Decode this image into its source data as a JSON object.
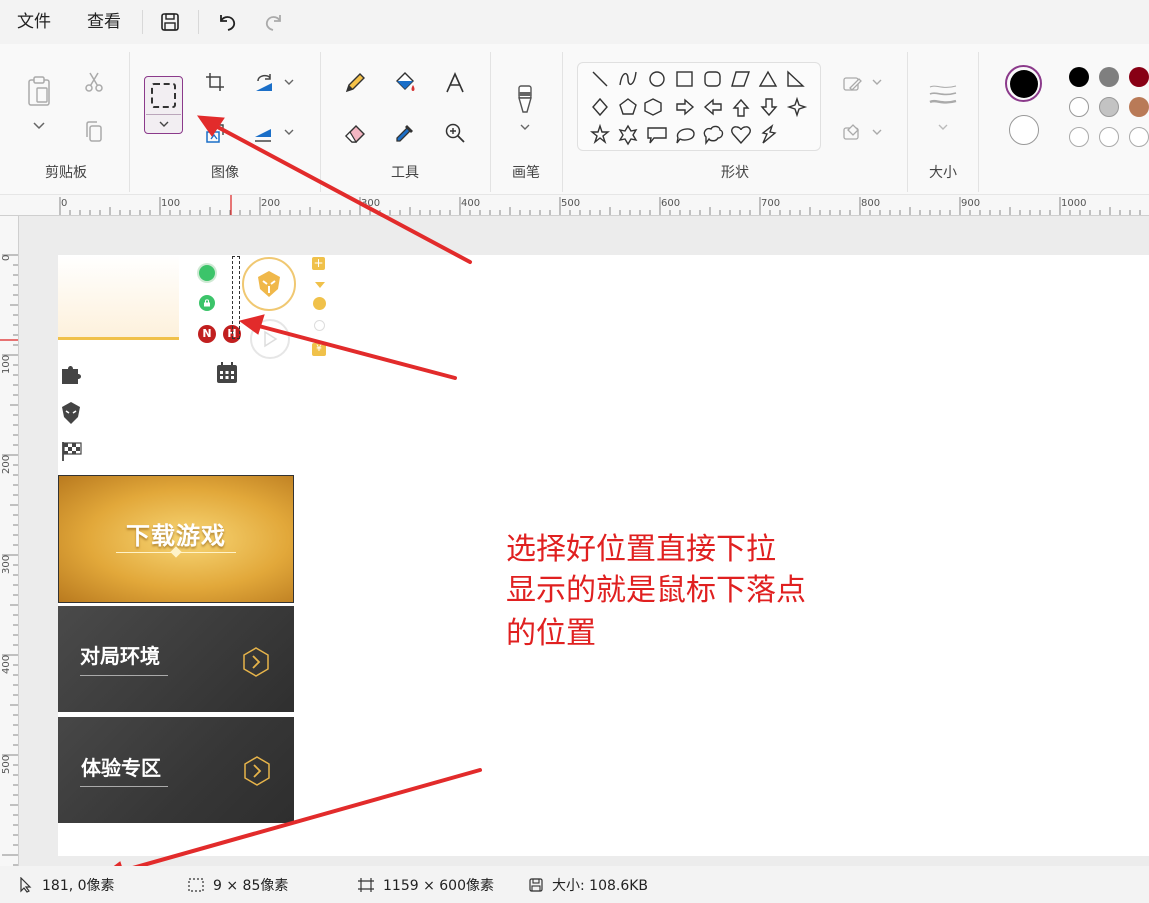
{
  "menu": {
    "file": "文件",
    "view": "查看"
  },
  "ribbon": {
    "groups": {
      "clipboard": "剪贴板",
      "image": "图像",
      "tools": "工具",
      "brush": "画笔",
      "shapes": "形状",
      "size": "大小"
    },
    "colors": {
      "primary": "#000000",
      "secondary": "#ffffff",
      "palette": [
        "#000000",
        "#7f7f7f",
        "#880015",
        "#ffffff",
        "#c3c3c3",
        "#b97a57",
        "#ffffff",
        "#ffffff",
        "#ffffff"
      ]
    }
  },
  "ruler": {
    "horizontal": [
      "0",
      "100",
      "200",
      "300",
      "400",
      "500",
      "600",
      "700",
      "800",
      "900",
      "1000"
    ],
    "vertical": [
      "0",
      "100",
      "200",
      "300",
      "400",
      "500"
    ]
  },
  "canvas": {
    "banner_download": "下载游戏",
    "card_match": "对局环境",
    "card_trial": "体验专区",
    "badge_n": "N",
    "badge_h": "H"
  },
  "annotation": {
    "lines": [
      "选择好位置直接下拉",
      "显示的就是鼠标下落点",
      "的位置"
    ]
  },
  "status": {
    "cursor": "181, 0像素",
    "selection": "9 × 85像素",
    "canvas_size": "1159 × 600像素",
    "file_size": "大小: 108.6KB"
  }
}
